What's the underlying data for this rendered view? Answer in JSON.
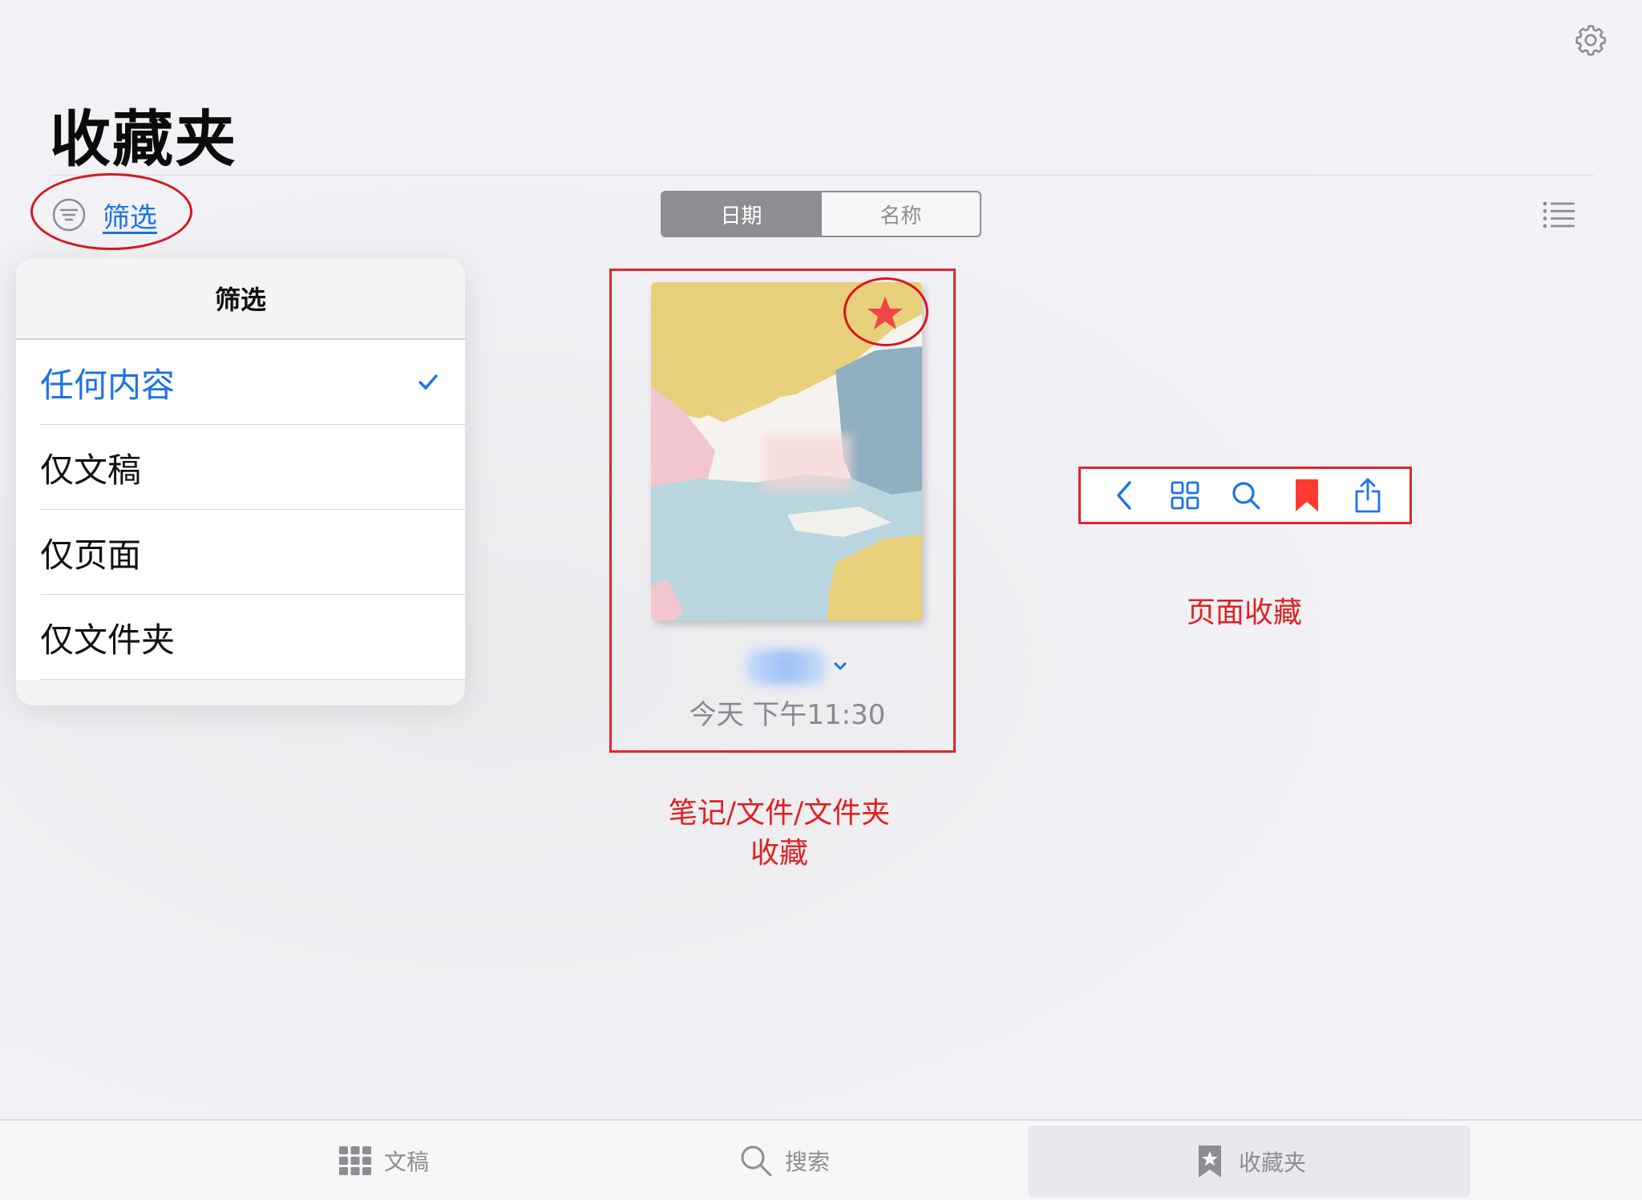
{
  "header": {
    "title": "收藏夹",
    "settings_icon": "gear-icon"
  },
  "filter": {
    "label": "筛选",
    "icon": "filter-circle-icon"
  },
  "sort_control": {
    "options": [
      "日期",
      "名称"
    ],
    "selected": "日期"
  },
  "view_toggle_icon": "list-view-icon",
  "popover": {
    "title": "筛选",
    "items": [
      {
        "label": "任何内容",
        "selected": true
      },
      {
        "label": "仅文稿",
        "selected": false
      },
      {
        "label": "仅页面",
        "selected": false
      },
      {
        "label": "仅文件夹",
        "selected": false
      }
    ]
  },
  "document": {
    "date": "今天 下午11:30",
    "favorite_icon": "star-icon"
  },
  "page_toolbar": {
    "icons": [
      "back-chevron-icon",
      "grid-icon",
      "search-icon",
      "bookmark-icon",
      "share-icon"
    ]
  },
  "annotations": {
    "note_line1": "笔记/文件/文件夹",
    "note_line2": "收藏",
    "page": "页面收藏"
  },
  "tabbar": {
    "items": [
      {
        "label": "文稿",
        "icon": "documents-grid-icon"
      },
      {
        "label": "搜索",
        "icon": "search-icon"
      },
      {
        "label": "收藏夹",
        "icon": "favorites-bookmark-icon",
        "active": true
      }
    ]
  },
  "colors": {
    "accent": "#1a73e8",
    "annotation_red": "#e0262b",
    "bookmark_red": "#ff3b30",
    "gray": "#8e8e92"
  }
}
